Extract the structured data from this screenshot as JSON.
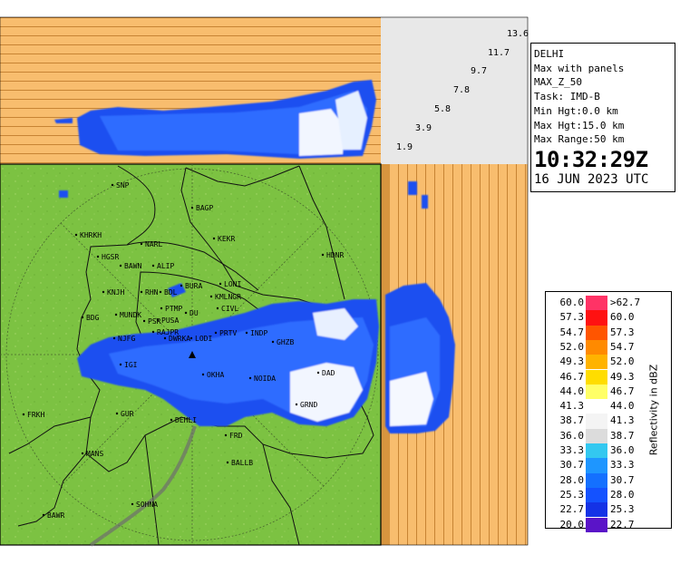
{
  "info": {
    "lines": [
      "DELHI",
      "Max with panels",
      "MAX_Z_50",
      "Task: IMD-B",
      "Min Hgt:0.0 km",
      "Max Hgt:15.0 km",
      "Max Range:50 km"
    ],
    "time": "10:32:29Z",
    "date": "16 JUN 2023 UTC"
  },
  "heights": [
    "13.6",
    "11.7",
    "9.7",
    "7.8",
    "5.8",
    "3.9",
    "1.9"
  ],
  "legend": {
    "title": "Reflectivity in dBZ",
    "rows": [
      {
        "low": "60.0",
        "high": ">62.7",
        "color": "#ff3366"
      },
      {
        "low": "57.3",
        "high": "60.0",
        "color": "#ff1111"
      },
      {
        "low": "54.7",
        "high": "57.3",
        "color": "#ff5500"
      },
      {
        "low": "52.0",
        "high": "54.7",
        "color": "#ff8a00"
      },
      {
        "low": "49.3",
        "high": "52.0",
        "color": "#ffb300"
      },
      {
        "low": "46.7",
        "high": "49.3",
        "color": "#ffdd00"
      },
      {
        "low": "44.0",
        "high": "46.7",
        "color": "#ffff66"
      },
      {
        "low": "41.3",
        "high": "44.0",
        "color": "#ffffff"
      },
      {
        "low": "38.7",
        "high": "41.3",
        "color": "#f4f4f4"
      },
      {
        "low": "36.0",
        "high": "38.7",
        "color": "#dcdcdc"
      },
      {
        "low": "33.3",
        "high": "36.0",
        "color": "#33c8f0"
      },
      {
        "low": "30.7",
        "high": "33.3",
        "color": "#1e96ff"
      },
      {
        "low": "28.0",
        "high": "30.7",
        "color": "#1470ff"
      },
      {
        "low": "25.3",
        "high": "28.0",
        "color": "#1452ff"
      },
      {
        "low": "22.7",
        "high": "25.3",
        "color": "#1432e6"
      },
      {
        "low": "20.0",
        "high": "22.7",
        "color": "#5a14c8"
      }
    ]
  },
  "stations": [
    {
      "name": "SNP"
    },
    {
      "name": "BAGP"
    },
    {
      "name": "KHRKH"
    },
    {
      "name": "KEKR"
    },
    {
      "name": "NARL"
    },
    {
      "name": "HGSR"
    },
    {
      "name": "BAWN"
    },
    {
      "name": "ALIP"
    },
    {
      "name": "HDNR"
    },
    {
      "name": "KNJH"
    },
    {
      "name": "RHN"
    },
    {
      "name": "BDL"
    },
    {
      "name": "BURA"
    },
    {
      "name": "LONI"
    },
    {
      "name": "KMLNGR"
    },
    {
      "name": "PTMP"
    },
    {
      "name": "CIVL"
    },
    {
      "name": "BDG"
    },
    {
      "name": "MUNDK"
    },
    {
      "name": "PSR"
    },
    {
      "name": "PUSA"
    },
    {
      "name": "DU"
    },
    {
      "name": "PRTV"
    },
    {
      "name": "INDP"
    },
    {
      "name": "RAJPR"
    },
    {
      "name": "NJFG"
    },
    {
      "name": "DWRKA"
    },
    {
      "name": "LODI"
    },
    {
      "name": "GHZB"
    },
    {
      "name": "IGI"
    },
    {
      "name": "OKHA"
    },
    {
      "name": "NOIDA"
    },
    {
      "name": "DAD"
    },
    {
      "name": "FRKH"
    },
    {
      "name": "GUR"
    },
    {
      "name": "DEHLI"
    },
    {
      "name": "GRND"
    },
    {
      "name": "FRD"
    },
    {
      "name": "MANS"
    },
    {
      "name": "BALLB"
    },
    {
      "name": "SOHNA"
    },
    {
      "name": "BAWR"
    }
  ],
  "colors": {
    "land": "#7cc242",
    "panel": "#f8bd6e",
    "panel_lines": "#d08a30",
    "side_gray": "#e6e6e6",
    "echo_blue": "#1e50f0",
    "echo_light": "#ffffff"
  }
}
